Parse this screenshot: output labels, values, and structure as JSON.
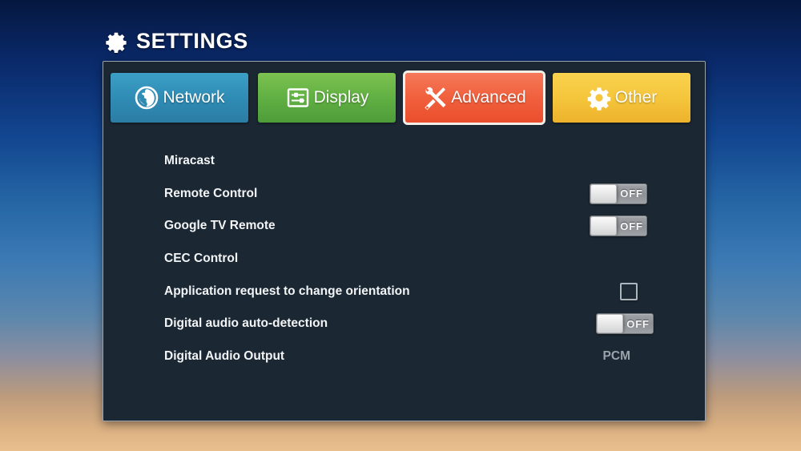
{
  "header": {
    "title": "SETTINGS",
    "icon": "gear-icon"
  },
  "panel": {
    "background_color": "#1b2733",
    "border_color": "#9aa3ab"
  },
  "tabs": [
    {
      "id": "network",
      "label": "Network",
      "icon": "globe-icon",
      "color": "#2f8cb5",
      "selected": false
    },
    {
      "id": "display",
      "label": "Display",
      "icon": "sliders-icon",
      "color": "#61b043",
      "selected": false
    },
    {
      "id": "advanced",
      "label": "Advanced",
      "icon": "tools-icon",
      "color": "#f1603d",
      "selected": true
    },
    {
      "id": "other",
      "label": "Other",
      "icon": "gear-icon",
      "color": "#f5c63c",
      "selected": false
    }
  ],
  "settings": [
    {
      "label": "Miracast",
      "control": "none"
    },
    {
      "label": "Remote Control",
      "control": "toggle",
      "state": "OFF"
    },
    {
      "label": "Google TV Remote",
      "control": "toggle",
      "state": "OFF"
    },
    {
      "label": "CEC Control",
      "control": "none"
    },
    {
      "label": "Application request to change orientation",
      "control": "checkbox",
      "checked": false
    },
    {
      "label": "Digital audio auto-detection",
      "control": "toggle",
      "state": "OFF"
    },
    {
      "label": "Digital Audio Output",
      "control": "value",
      "value": "PCM"
    }
  ]
}
